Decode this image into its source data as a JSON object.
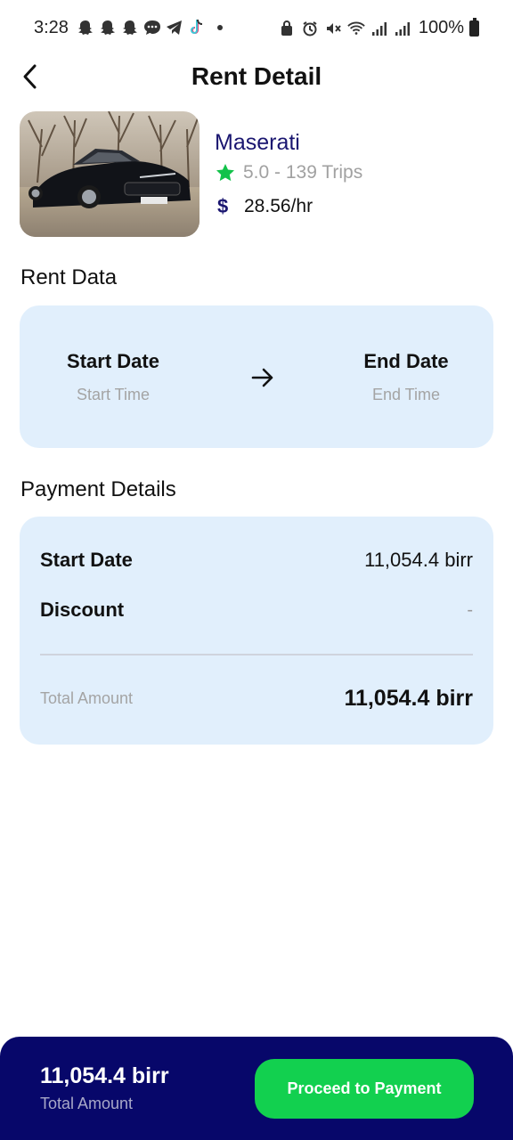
{
  "status_bar": {
    "time": "3:28",
    "battery": "100%",
    "icons": [
      "snapchat-icon",
      "snapchat-icon",
      "snapchat-icon",
      "chat-icon",
      "telegram-icon",
      "tiktok-icon",
      "dot-icon",
      "alarm-lock-icon",
      "alarm-icon",
      "mute-icon",
      "wifi-icon",
      "signal-icon",
      "signal-icon",
      "battery-icon"
    ]
  },
  "header": {
    "title": "Rent Detail",
    "back_icon": "chevron-left-icon"
  },
  "car": {
    "name": "Maserati",
    "rating": "5.0 - 139 Trips",
    "price": "28.56/hr",
    "rating_icon": "star-icon",
    "price_icon": "dollar-icon",
    "star_color": "#12c24a",
    "name_color": "#1a1670"
  },
  "rent_data": {
    "section_title": "Rent Data",
    "start_label": "Start Date",
    "start_sub": "Start Time",
    "end_label": "End Date",
    "end_sub": "End Time",
    "arrow_icon": "arrow-right-icon"
  },
  "payment": {
    "section_title": "Payment Details",
    "rows": [
      {
        "label": "Start Date",
        "value": "11,054.4 birr"
      },
      {
        "label": "Discount",
        "value": "-"
      }
    ],
    "total_label": "Total Amount",
    "total_value": "11,054.4 birr"
  },
  "bottom_bar": {
    "amount": "11,054.4 birr",
    "label": "Total Amount",
    "button_label": "Proceed to Payment",
    "background": "#07076a",
    "button_color": "#12d04f"
  }
}
